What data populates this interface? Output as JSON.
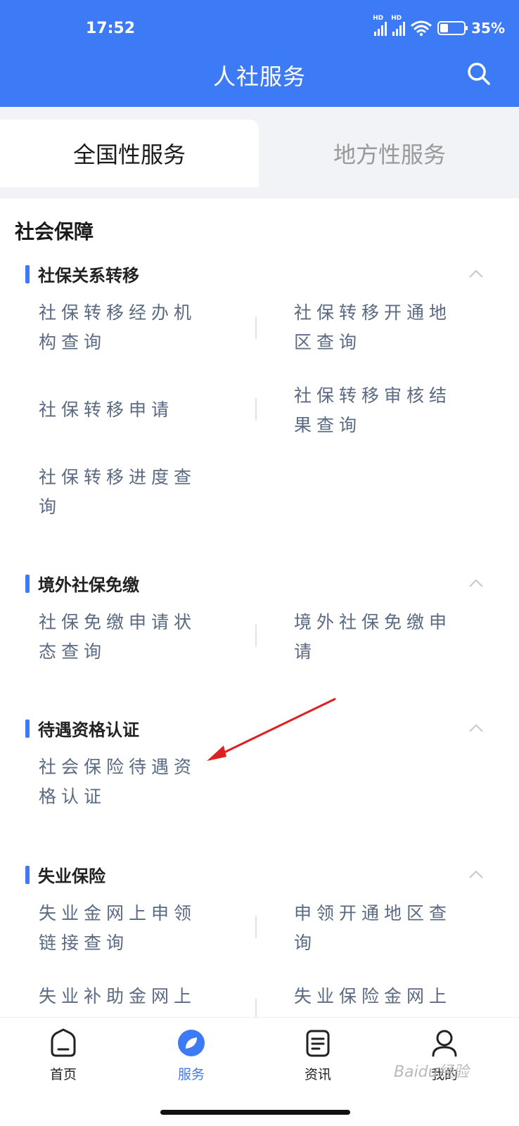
{
  "status_bar": {
    "time": "17:52",
    "battery": "35%",
    "battery_level": 0.35,
    "network_label": "HD"
  },
  "header": {
    "title": "人社服务"
  },
  "tabs": [
    {
      "label": "全国性服务",
      "active": true
    },
    {
      "label": "地方性服务",
      "active": false
    }
  ],
  "section": {
    "title": "社会保障"
  },
  "groups": [
    {
      "title": "社保关系转移",
      "items": [
        "社保转移经办机构查询",
        "社保转移开通地区查询",
        "社保转移申请",
        "社保转移审核结果查询",
        "社保转移进度查询"
      ]
    },
    {
      "title": "境外社保免缴",
      "items": [
        "社保免缴申请状态查询",
        "境外社保免缴申请"
      ]
    },
    {
      "title": "待遇资格认证",
      "items": [
        "社会保险待遇资格认证"
      ]
    },
    {
      "title": "失业保险",
      "items": [
        "失业金网上申领链接查询",
        "申领开通地区查询",
        "失业补助金网上",
        "失业保险金网上"
      ]
    }
  ],
  "bottom_nav": [
    {
      "label": "首页",
      "icon": "home-icon",
      "active": false
    },
    {
      "label": "服务",
      "icon": "compass-leaf-icon",
      "active": true
    },
    {
      "label": "资讯",
      "icon": "document-icon",
      "active": false
    },
    {
      "label": "我的",
      "icon": "person-icon",
      "active": false
    }
  ],
  "watermark": "Baidu经验",
  "colors": {
    "accent": "#3d7af5",
    "item_text": "#5a6a82",
    "arrow": "#e02020"
  }
}
